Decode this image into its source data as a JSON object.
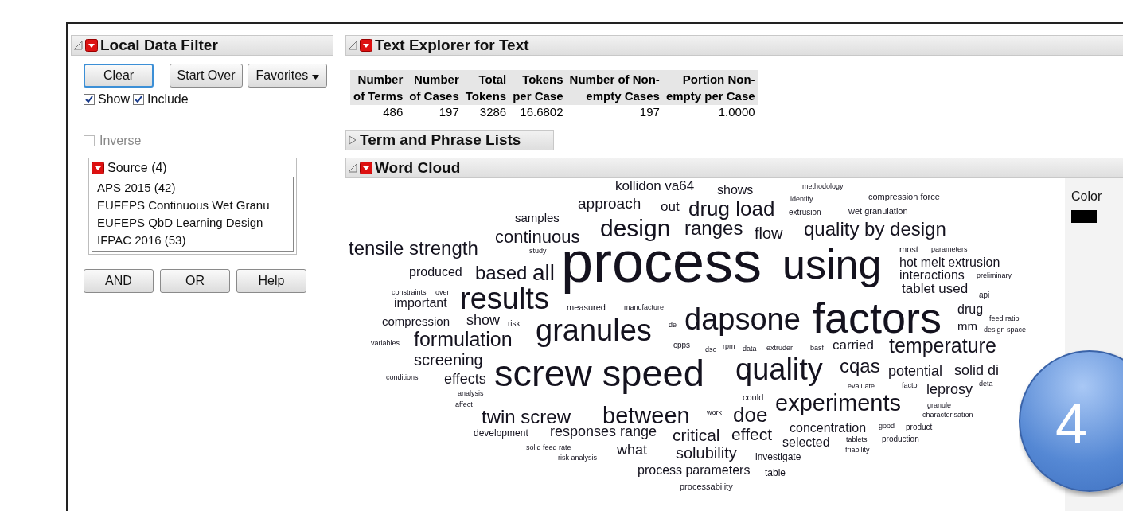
{
  "filter_panel": {
    "title": "Local Data Filter",
    "clear_button": "Clear",
    "start_over_button": "Start Over",
    "favorites_button": "Favorites",
    "show": {
      "label": "Show",
      "checked": true
    },
    "include": {
      "label": "Include",
      "checked": true
    },
    "inverse": {
      "label": "Inverse",
      "checked": false,
      "disabled": true
    },
    "source": {
      "title": "Source (4)",
      "items": [
        {
          "label": "APS 2015 (42)",
          "selected": false
        },
        {
          "label": "EUFEPS Continuous Wet Granu",
          "selected": false
        },
        {
          "label": "EUFEPS QbD Learning Design",
          "selected": false
        },
        {
          "label": "IFPAC 2016 (53)",
          "selected": false
        }
      ]
    },
    "buttons": [
      "AND",
      "OR",
      "Help"
    ]
  },
  "explorer": {
    "title": "Text Explorer for Text",
    "expanded": true,
    "summary": {
      "columns": [
        [
          "Number",
          "of Terms"
        ],
        [
          "Number",
          "of Cases"
        ],
        [
          "Total",
          "Tokens"
        ],
        [
          "Tokens",
          "per Case"
        ],
        [
          "Number of Non-",
          "empty Cases"
        ],
        [
          "Portion Non-",
          "empty per Case"
        ]
      ],
      "values": [
        "486",
        "197",
        "3286",
        "16.6802",
        "197",
        "1.0000"
      ]
    },
    "term_lists": {
      "title": "Term and Phrase Lists",
      "expanded": false
    },
    "word_cloud": {
      "title": "Word Cloud",
      "expanded": true,
      "legend_label": "Color",
      "words": [
        "kollidon va64",
        "shows",
        "methodology",
        "identify",
        "compression force",
        "approach",
        "out",
        "drug load",
        "samples",
        "extrusion",
        "wet granulation",
        "continuous",
        "design",
        "ranges",
        "flow",
        "quality by design",
        "tensile strength",
        "study",
        "most",
        "parameters",
        "process",
        "using",
        "hot melt extrusion",
        "produced",
        "based",
        "all",
        "interactions",
        "preliminary",
        "constraints",
        "over",
        "tablet used",
        "api",
        "important",
        "results",
        "measured",
        "manufacture",
        "drug",
        "compression",
        "show",
        "risk",
        "dapsone",
        "factors",
        "feed ratio",
        "granules",
        "de",
        "mm",
        "design space",
        "variables",
        "formulation",
        "cpps",
        "dsc",
        "rpm",
        "data",
        "extruder",
        "basf",
        "carried",
        "temperature",
        "screening",
        "quality",
        "cqas",
        "potential",
        "solid di",
        "conditions",
        "effects",
        "screw speed",
        "evaluate",
        "factor",
        "leprosy",
        "deta",
        "analysis",
        "could",
        "affect",
        "experiments",
        "granule",
        "twin screw",
        "between",
        "work",
        "doe",
        "characterisation",
        "concentration",
        "good",
        "product",
        "development",
        "responses range",
        "critical",
        "effect",
        "production",
        "solid feed rate",
        "selected",
        "tablets",
        "risk analysis",
        "what",
        "solubility",
        "investigate",
        "friability",
        "process parameters",
        "table",
        "processability"
      ]
    }
  },
  "badge": "4"
}
